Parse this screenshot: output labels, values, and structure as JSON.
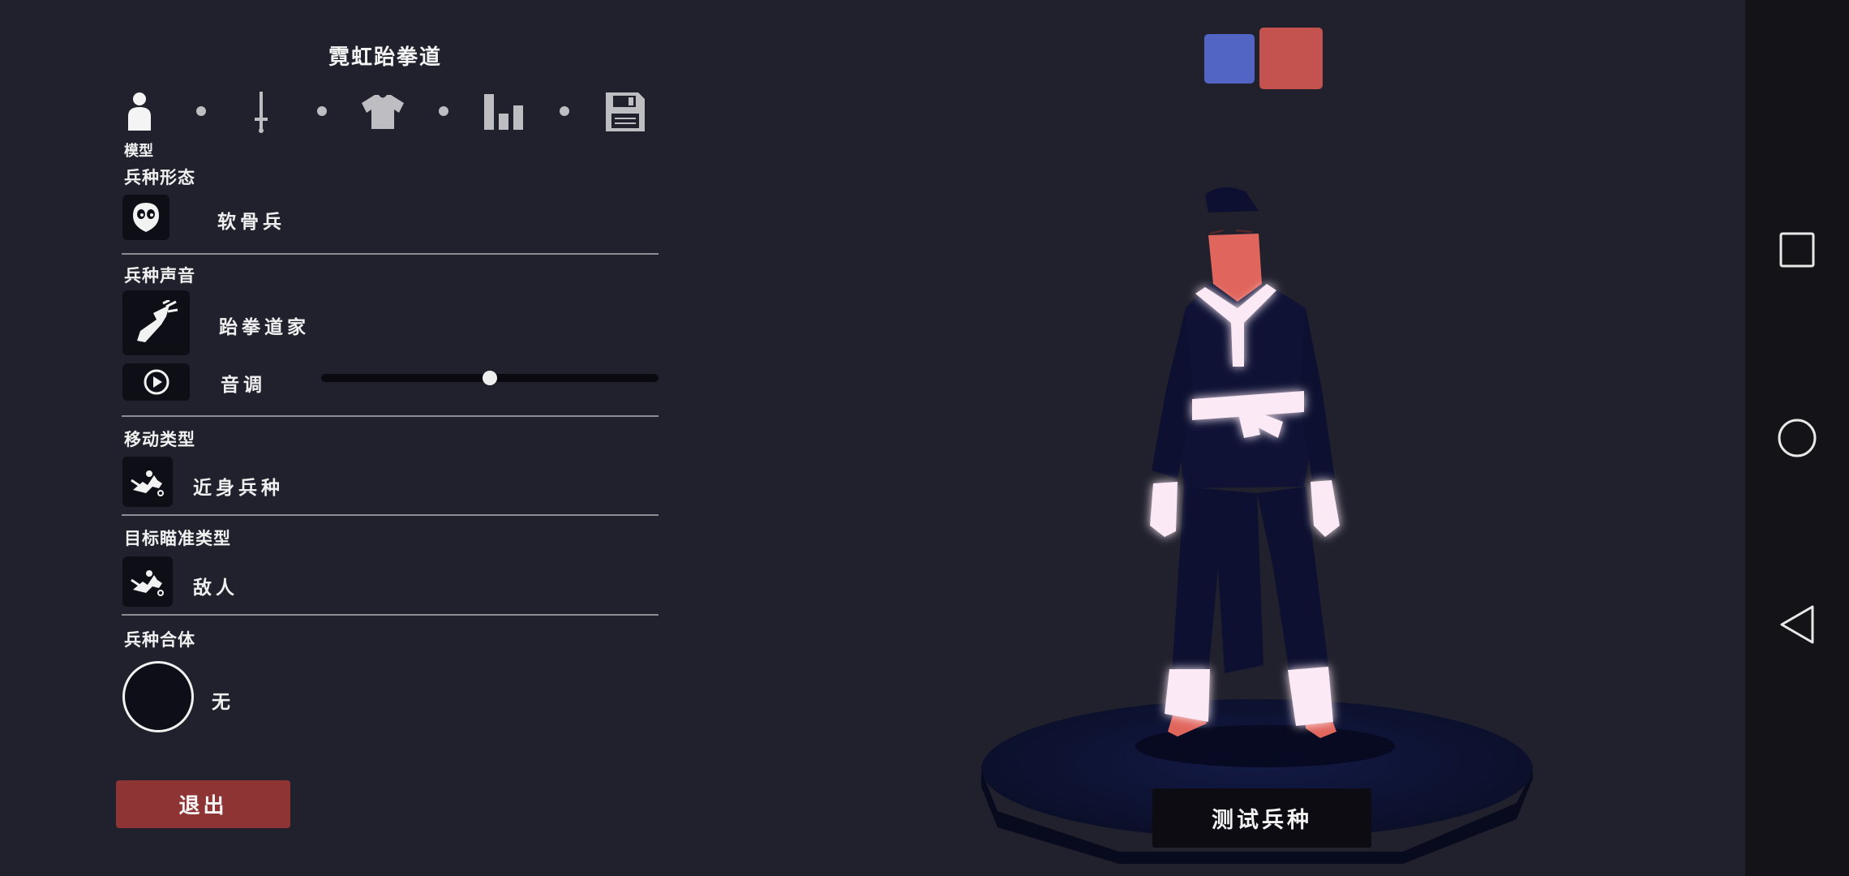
{
  "title": "霓虹跆拳道",
  "tabs": [
    {
      "icon": "person-icon",
      "label": "模型",
      "active": true
    },
    {
      "icon": "sword-icon",
      "label": "",
      "active": false
    },
    {
      "icon": "shirt-icon",
      "label": "",
      "active": false
    },
    {
      "icon": "stats-icon",
      "label": "",
      "active": false
    },
    {
      "icon": "save-icon",
      "label": "",
      "active": false
    }
  ],
  "sections": {
    "form": {
      "label": "兵种形态",
      "value": "软骨兵",
      "icon": "mask-face-icon"
    },
    "voice": {
      "label": "兵种声音",
      "value": "跆拳道家",
      "icon": "kick-icon",
      "pitch_label": "音调",
      "pitch_value": 0.5,
      "play_icon": "play-icon"
    },
    "movement": {
      "label": "移动类型",
      "value": "近身兵种",
      "icon": "melee-unit-icon"
    },
    "targeting": {
      "label": "目标瞄准类型",
      "value": "敌人",
      "icon": "target-unit-icon"
    },
    "combine": {
      "label": "兵种合体",
      "value": "无"
    }
  },
  "buttons": {
    "exit": "退出",
    "test_unit": "测试兵种"
  },
  "teams": [
    {
      "name": "blue-team",
      "color": "#5264c4",
      "selected": false
    },
    {
      "name": "red-team",
      "color": "#c4524f",
      "selected": true
    }
  ],
  "colors": {
    "background": "#21212d",
    "exit_button": "#8e3434",
    "skin": "#e0655c",
    "robe": "#0d1030",
    "neon_trim": "#ffffff",
    "pedestal": "#0c1030"
  },
  "nav": {
    "recent_icon": "square-icon",
    "home_icon": "circle-icon",
    "back_icon": "triangle-back-icon"
  }
}
